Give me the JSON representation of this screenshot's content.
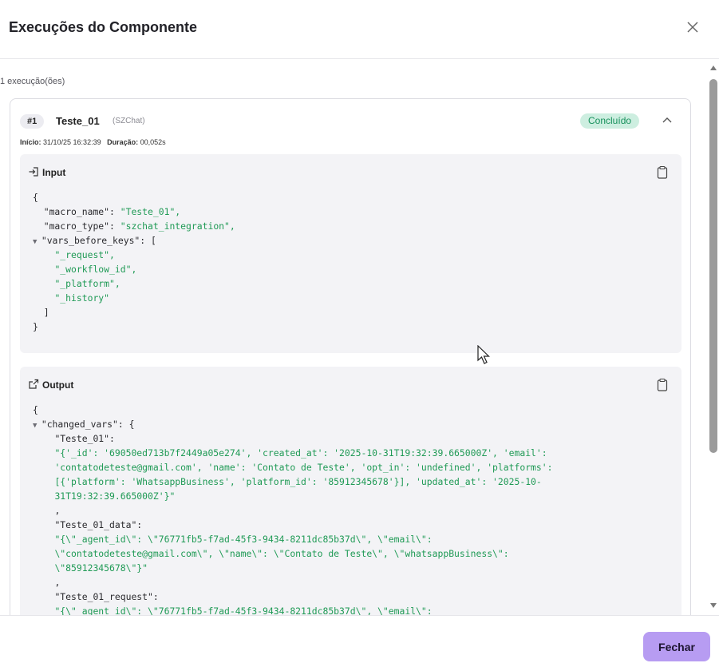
{
  "header": {
    "title": "Execuções do Componente"
  },
  "summary": {
    "count_text": "1 execução(ões)"
  },
  "execution": {
    "number": "#1",
    "name": "Teste_01",
    "type": "(SZChat)",
    "status": "Concluído",
    "start_label": "Início:",
    "start_value": "31/10/25 16:32:39",
    "duration_label": "Duração:",
    "duration_value": "00,052s"
  },
  "input_panel": {
    "title": "Input",
    "lines": [
      "{",
      "  \"macro_name\": \"Teste_01\",",
      "  \"macro_type\": \"szchat_integration\",",
      "  \"vars_before_keys\": [",
      "    \"_request\",",
      "    \"_workflow_id\",",
      "    \"_platform\",",
      "    \"_history\"",
      "  ]",
      "}"
    ]
  },
  "output_panel": {
    "title": "Output",
    "lines": [
      "{",
      "  \"changed_vars\": {",
      "    \"Teste_01\":",
      "    \"{'_id': '69050ed713b7f2449a05e274', 'created_at': '2025-10-31T19:32:39.665000Z', 'email':",
      "    'contatodeteste@gmail.com', 'name': 'Contato de Teste', 'opt_in': 'undefined', 'platforms':",
      "    [{'platform': 'WhatsappBusiness', 'platform_id': '85912345678'}], 'updated_at': '2025-10-",
      "    31T19:32:39.665000Z'}\"",
      "    ,",
      "    \"Teste_01_data\":",
      "    \"{\\\"_agent_id\\\": \\\"76771fb5-f7ad-45f3-9434-8211dc85b37d\\\", \\\"email\\\":",
      "    \\\"contatodeteste@gmail.com\\\", \\\"name\\\": \\\"Contato de Teste\\\", \\\"whatsappBusiness\\\":",
      "    \\\"85912345678\\\"}\"",
      "    ,",
      "    \"Teste_01_request\":",
      "    \"{\\\"_agent_id\\\": \\\"76771fb5-f7ad-45f3-9434-8211dc85b37d\\\", \\\"email\\\":"
    ]
  },
  "footer": {
    "close_label": "Fechar"
  },
  "icons": {
    "close": "close-icon",
    "collapse": "chevron-up-icon",
    "input": "input-icon",
    "output": "external-link-icon",
    "copy": "clipboard-icon",
    "toggle": "triangle-down-icon"
  },
  "colors": {
    "accent": "#b79cf2",
    "status_bg": "#cdeee0",
    "status_text": "#18915c",
    "string": "#1f9a55",
    "panel_bg": "#f3f3f6"
  }
}
